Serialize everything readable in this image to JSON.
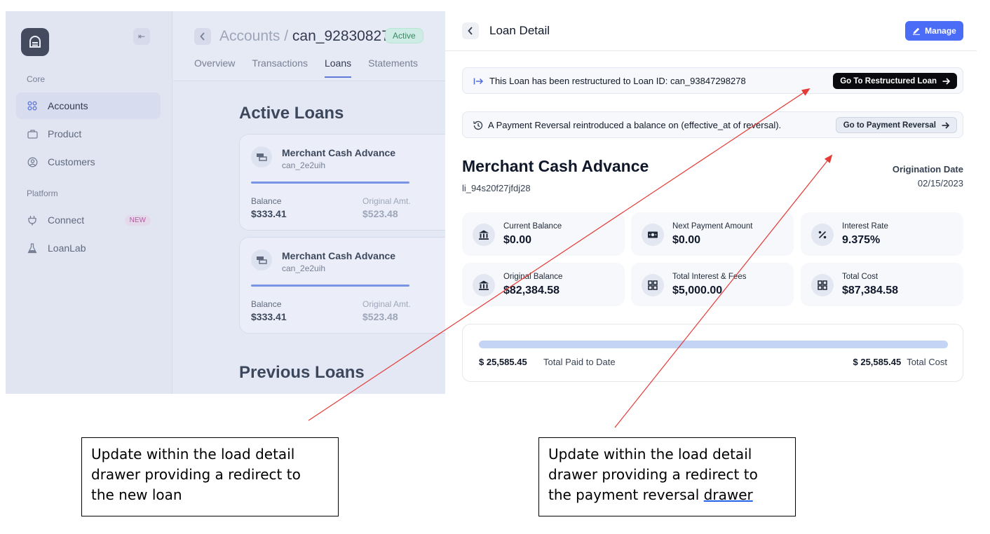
{
  "sidebar": {
    "collapse_icon": "collapse-left-icon",
    "sections": [
      {
        "label": "Core"
      },
      {
        "label": "Platform"
      }
    ],
    "items": [
      {
        "label": "Accounts",
        "icon": "grid-icon",
        "active": true
      },
      {
        "label": "Product",
        "icon": "briefcase-icon"
      },
      {
        "label": "Customers",
        "icon": "user-circle-icon"
      },
      {
        "label": "Connect",
        "icon": "plug-icon",
        "badge": "NEW"
      },
      {
        "label": "LoanLab",
        "icon": "flask-icon"
      }
    ]
  },
  "header": {
    "breadcrumb_parent": "Accounts",
    "breadcrumb_separator": "/",
    "breadcrumb_current": "can_92830827",
    "status": "Active",
    "tabs": [
      {
        "label": "Overview"
      },
      {
        "label": "Transactions"
      },
      {
        "label": "Loans",
        "active": true
      },
      {
        "label": "Statements"
      }
    ]
  },
  "main": {
    "active_heading": "Active Loans",
    "previous_heading": "Previous Loans",
    "loans": [
      {
        "title": "Merchant Cash Advance",
        "id": "can_2e2uih",
        "balance_label": "Balance",
        "balance": "$333.41",
        "original_label": "Original Amt.",
        "original": "$523.48"
      },
      {
        "title": "Merchant Cash Advance",
        "id": "can_2e2uih",
        "balance_label": "Balance",
        "balance": "$333.41",
        "original_label": "Original Amt.",
        "original": "$523.48"
      }
    ]
  },
  "drawer": {
    "title": "Loan Detail",
    "manage_label": "Manage",
    "banners": [
      {
        "text": "This Loan has been restructured to Loan ID: can_93847298278",
        "button": "Go To Restructured Loan",
        "icon": "arrow-right-to-icon"
      },
      {
        "text": "A Payment Reversal reintroduced a balance on (effective_at of reversal).",
        "button": "Go to Payment Reversal",
        "icon": "history-icon"
      }
    ],
    "loan_name": "Merchant Cash Advance",
    "loan_id": "li_94s20f27jfdj28",
    "origination_label": "Origination Date",
    "origination_date": "02/15/2023",
    "stats": [
      {
        "label": "Current Balance",
        "value": "$0.00",
        "icon": "bank-icon"
      },
      {
        "label": "Next Payment Amount",
        "value": "$0.00",
        "icon": "cash-icon"
      },
      {
        "label": "Interest Rate",
        "value": "9.375%",
        "icon": "percent-icon"
      },
      {
        "label": "Original Balance",
        "value": "$82,384.58",
        "icon": "bank-icon"
      },
      {
        "label": "Total Interest & Fees",
        "value": "$5,000.00",
        "icon": "grid-icon"
      },
      {
        "label": "Total Cost",
        "value": "$87,384.58",
        "icon": "grid-icon"
      }
    ],
    "progress": {
      "fraction": 1.0,
      "paid_value": "$ 25,585.45",
      "paid_label": "Total Paid to Date",
      "cost_value": "$ 25,585.45",
      "cost_label": "Total Cost"
    }
  },
  "annotations": {
    "note_1_l1": "Update within the load detail",
    "note_1_l2": "drawer providing a redirect to",
    "note_1_l3": "the new loan",
    "note_2_l1": "Update within the load detail",
    "note_2_l2": "drawer providing a redirect to",
    "note_2_l3": "the payment reversal ",
    "note_2_underlined": "drawer",
    "arrow_color": "#e53935"
  },
  "colors": {
    "accent": "#4a6cf7",
    "dark_button": "#0b0b0f",
    "status_green": "#15803d"
  }
}
